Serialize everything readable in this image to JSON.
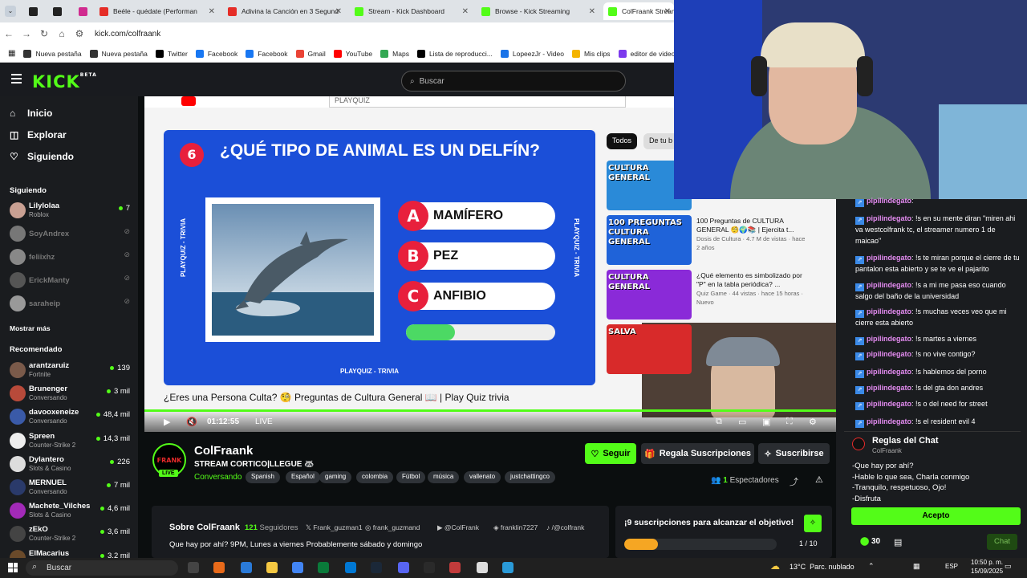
{
  "browser": {
    "tabs": [
      {
        "label": "",
        "active": false
      },
      {
        "label": "",
        "active": false
      },
      {
        "label": "",
        "active": false
      },
      {
        "label": "Beéle - quédate (Performan",
        "active": false
      },
      {
        "label": "Adivina la Canción en 3 Segund",
        "active": false
      },
      {
        "label": "Stream - Kick Dashboard",
        "active": false
      },
      {
        "label": "Browse - Kick Streaming",
        "active": false
      },
      {
        "label": "ColFraank Stream",
        "active": true
      }
    ],
    "url": "kick.com/colfraank",
    "bookmarks": [
      "Nueva pestaña",
      "Nueva pestaña",
      "Twitter",
      "Facebook",
      "Facebook",
      "Gmail",
      "YouTube",
      "Maps",
      "Lista de reproducci...",
      "LopeezJr - Video",
      "Mis clips",
      "editor de videos onl"
    ]
  },
  "header": {
    "logo": "KICK",
    "beta": "BETA",
    "search_placeholder": "Buscar"
  },
  "sidebar": {
    "nav": [
      {
        "label": "Inicio",
        "icon": "home-icon"
      },
      {
        "label": "Explorar",
        "icon": "compass-icon"
      },
      {
        "label": "Siguiendo",
        "icon": "heart-icon"
      }
    ],
    "following_title": "Siguiendo",
    "following": [
      {
        "name": "Lilylolaa",
        "category": "Roblox",
        "viewers": "7",
        "live": true,
        "color": "#c9a093"
      },
      {
        "name": "SoyAndrex",
        "category": "",
        "viewers": "",
        "live": false,
        "color": "#777"
      },
      {
        "name": "feliixhz",
        "category": "",
        "viewers": "",
        "live": false,
        "color": "#888"
      },
      {
        "name": "ErickManty",
        "category": "",
        "viewers": "",
        "live": false,
        "color": "#555"
      },
      {
        "name": "saraheip",
        "category": "",
        "viewers": "",
        "live": false,
        "color": "#999"
      }
    ],
    "show_more": "Mostrar más",
    "recommended_title": "Recomendado",
    "recommended": [
      {
        "name": "arantzaruiz",
        "category": "Fortnite",
        "viewers": "139",
        "color": "#7a5a4a"
      },
      {
        "name": "Brunenger",
        "category": "Conversando",
        "viewers": "3 mil",
        "color": "#b84a3a"
      },
      {
        "name": "davooxeneize",
        "category": "Conversando",
        "viewers": "48,4 mil",
        "color": "#3a5aa8"
      },
      {
        "name": "Spreen",
        "category": "Counter-Strike 2",
        "viewers": "14,3 mil",
        "color": "#eee"
      },
      {
        "name": "Dylantero",
        "category": "Slots & Casino",
        "viewers": "226",
        "color": "#dddddd"
      },
      {
        "name": "MERNUEL",
        "category": "Conversando",
        "viewers": "7 mil",
        "color": "#2a3a6a"
      },
      {
        "name": "Machete_Vilches",
        "category": "Slots & Casino",
        "viewers": "4,6 mil",
        "color": "#a22ab8"
      },
      {
        "name": "zEkO",
        "category": "Counter-Strike 2",
        "viewers": "3,6 mil",
        "color": "#444"
      },
      {
        "name": "ElMacarius",
        "category": "",
        "viewers": "3,2 mil",
        "color": "#6a4a2a"
      }
    ]
  },
  "video": {
    "yt_search": "PLAYQUIZ",
    "quiz_number": "6",
    "question": "¿QUÉ TIPO DE ANIMAL ES UN DELFÍN?",
    "answers": [
      {
        "letter": "A",
        "text": "MAMÍFERO"
      },
      {
        "letter": "B",
        "text": "PEZ"
      },
      {
        "letter": "C",
        "text": "ANFIBIO"
      }
    ],
    "timer_fraction": 0.33,
    "side_label": "PLAYQUIZ - TRIVIA",
    "bottom_label": "PLAYQUIZ - TRIVIA",
    "yt_title": "¿Eres una Persona Culta? 🧐 Preguntas de Cultura General 📖 | Play Quiz trivia",
    "chips": [
      "Todos",
      "De tu b"
    ],
    "recs": [
      {
        "thumb": "CULTURA GENERAL",
        "title": "",
        "meta": "",
        "color": "#2a8ad8"
      },
      {
        "thumb": "100 PREGUNTAS CULTURA GENERAL",
        "title": "100 Preguntas de CULTURA GENERAL 🧐🌍📚 | Ejercita t...",
        "meta": "Dosis de Cultura · 4.7 M de vistas · hace 2 años",
        "color": "#1f63d9"
      },
      {
        "thumb": "CULTURA GENERAL",
        "title": "¿Qué elemento es simbolizado por \"P\" en la tabla periódica? ...",
        "meta": "Quiz Game · 44 vistas · hace 15 horas · Nuevo",
        "color": "#8a2ad8"
      },
      {
        "thumb": "SALVA",
        "title": "",
        "meta": "",
        "color": "#d82a2a"
      }
    ],
    "time": "01:12:55",
    "live": "LIVE"
  },
  "channel": {
    "name": "ColFraank",
    "avatar_text": "FRANK",
    "live_badge": "LIVE",
    "title": "STREAM CORTICO|LLEGUE 🦝",
    "category": "Conversando",
    "tags": [
      "Spanish",
      "Español",
      "gaming",
      "colombia",
      "Fútbol",
      "música",
      "vallenato",
      "justchattingco"
    ],
    "follow": "Seguir",
    "gift": "Regala Suscripciones",
    "subscribe": "Suscribirse",
    "viewers_count": "1",
    "viewers_label": "Espectadores"
  },
  "about": {
    "title": "Sobre ColFraank",
    "followers_count": "121",
    "followers_label": "Seguidores",
    "socials": [
      "Frank_guzman1",
      "frank_guzmand",
      "@ColFrank",
      "franklin7227",
      "/@colfrank"
    ],
    "description": "Que hay por ahí? 9PM, Lunes a viernes Probablemente sábado y domingo"
  },
  "goal": {
    "text": "¡9 suscripciones para alcanzar el objetivo!",
    "progress": "1 / 10",
    "fraction": 0.1
  },
  "chat": {
    "messages": [
      {
        "user": "pipilindegato",
        "text": ""
      },
      {
        "user": "pipilindegato",
        "text": "!s en su mente diran \"miren ahi va westcolfrank tc, el streamer numero 1 de maicao\""
      },
      {
        "user": "pipilindegato",
        "text": "!s te miran porque el cierre de tu pantalon esta abierto y se te ve el pajarito"
      },
      {
        "user": "pipilindegato",
        "text": "!s a mi me pasa eso cuando salgo del baño de la universidad"
      },
      {
        "user": "pipilindegato",
        "text": "!s muchas veces veo que mi cierre esta abierto"
      },
      {
        "user": "pipilindegato",
        "text": "!s martes a viernes"
      },
      {
        "user": "pipilindegato",
        "text": "!s no vive contigo?"
      },
      {
        "user": "pipilindegato",
        "text": "!s hablemos del porno"
      },
      {
        "user": "pipilindegato",
        "text": "!s del gta don andres"
      },
      {
        "user": "pipilindegato",
        "text": "!s o del need for street"
      },
      {
        "user": "pipilindegato",
        "text": "!s el resident evil 4"
      }
    ],
    "rules_title": "Reglas del Chat",
    "rules_owner": "ColFraank",
    "rules": [
      "-Que hay por ahí?",
      "-Hable lo que sea, Charla conmigo",
      "-Tranquilo, respetuoso, Ojo!",
      "-Disfruta"
    ],
    "accept": "Acepto",
    "points": "30",
    "chat_button": "Chat"
  },
  "taskbar": {
    "search": "Buscar",
    "weather": "13°C  Parc. nublado",
    "lang": "ESP",
    "time": "10:50 p. m.",
    "date": "15/09/2025"
  }
}
